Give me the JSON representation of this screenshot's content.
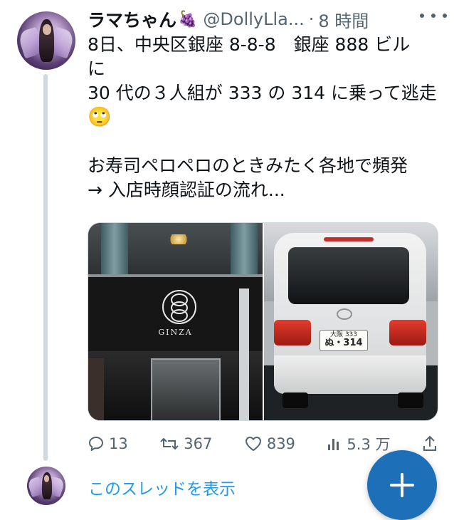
{
  "tweet": {
    "author": {
      "display_name": "ラマちゃん",
      "badge_emoji": "🍇",
      "handle": "@DollyLla...",
      "separator": "·",
      "time": "8 時間"
    },
    "text_lines": [
      "8日、中央区銀座 8-8-8　銀座 888 ビル",
      "に",
      "30 代の３人組が 333 の 314 に乗って逃走",
      "🙄",
      "",
      "お寿司ペロペロのときみたく各地で頻発",
      "→ 入店時顔認証の流れ..."
    ],
    "media": {
      "photo1": {
        "caption": "GINZA"
      },
      "photo2": {
        "plate_top": "大阪 333",
        "plate_bottom": "ぬ・314"
      }
    },
    "actions": {
      "replies": "13",
      "retweets": "367",
      "likes": "839",
      "views": "5.3 万"
    }
  },
  "thread": {
    "show_thread_label": "このスレッドを表示"
  },
  "colors": {
    "accent": "#1d9bf0",
    "secondary_text": "#536471",
    "fab": "#1d6fb8",
    "thread_line": "#cfd9de"
  },
  "icons": [
    "more-icon",
    "reply-icon",
    "retweet-icon",
    "like-icon",
    "views-icon",
    "share-icon",
    "compose-plus-icon"
  ]
}
